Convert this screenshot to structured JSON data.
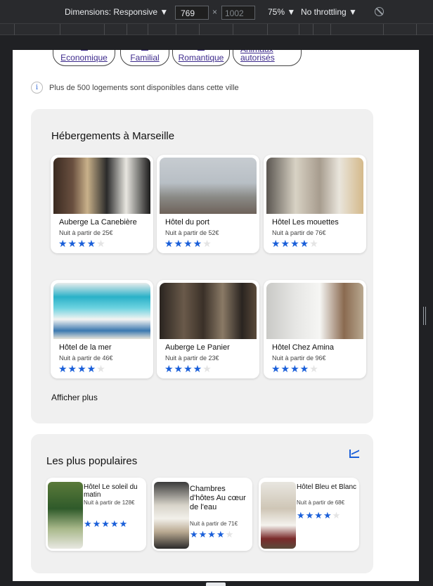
{
  "devtools": {
    "dimensions_label": "Dimensions: Responsive ▼",
    "width": "769",
    "height_placeholder": "1002",
    "times": "×",
    "zoom": "75% ▼",
    "throttling": "No throttling ▼"
  },
  "filters": [
    "Economique",
    "Familial",
    "Romantique",
    "Animaux autorisés"
  ],
  "info": {
    "icon_glyph": "i",
    "text": "Plus de 500 logements sont disponibles dans cette ville"
  },
  "accommodations": {
    "title": "Hébergements à Marseille",
    "cards": [
      {
        "name": "Auberge La Canebière",
        "price": "Nuit à partir de 25€",
        "stars": 4
      },
      {
        "name": "Hôtel du port",
        "price": "Nuit à partir de 52€",
        "stars": 4
      },
      {
        "name": "Hôtel Les mouettes",
        "price": "Nuit à partir de 76€",
        "stars": 4
      },
      {
        "name": "Hôtel de la mer",
        "price": "Nuit à partir de 46€",
        "stars": 4
      },
      {
        "name": "Auberge Le Panier",
        "price": "Nuit à partir de 23€",
        "stars": 4
      },
      {
        "name": "Hôtel Chez Amina",
        "price": "Nuit à partir de 96€",
        "stars": 4
      }
    ],
    "show_more": "Afficher plus"
  },
  "popular": {
    "title": "Les plus populaires",
    "cards": [
      {
        "name": "Hôtel Le soleil du matin",
        "price": "Nuit à partir de 128€",
        "stars": 5
      },
      {
        "name": "Chambres d'hôtes Au cœur de l'eau",
        "price": "Nuit à partir de 71€",
        "stars": 4
      },
      {
        "name": "Hôtel Bleu et Blanc",
        "price": "Nuit à partir de 68€",
        "stars": 4
      }
    ]
  },
  "colors": {
    "accent": "#1a5fd9",
    "link": "#3d2a8c",
    "panel": "#f0f0f0"
  }
}
